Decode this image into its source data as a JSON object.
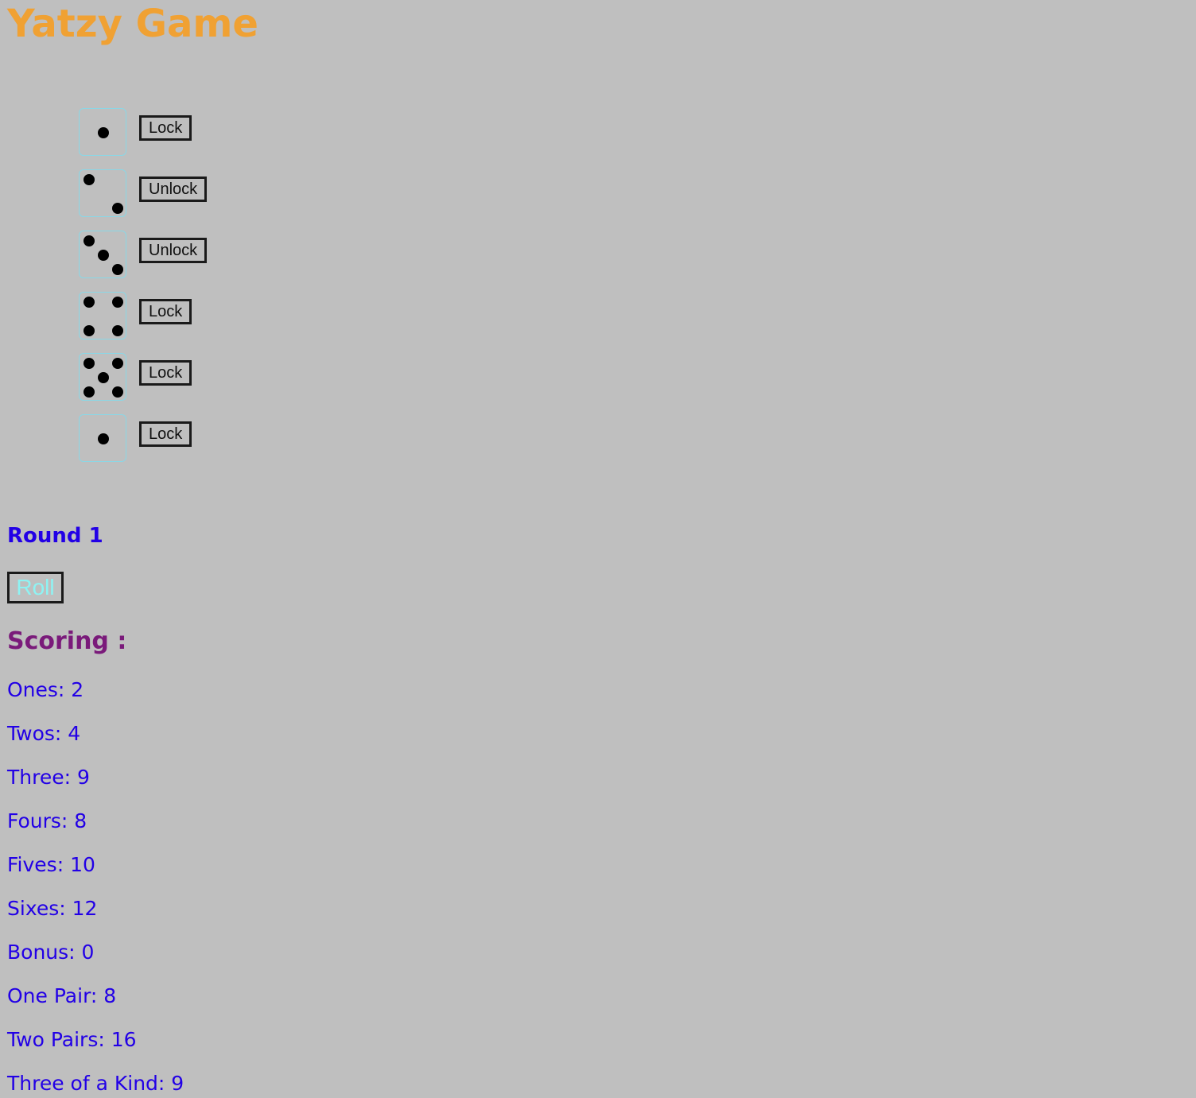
{
  "title": "Yatzy Game",
  "dice": [
    {
      "value": 1,
      "button_label": "Lock"
    },
    {
      "value": 2,
      "button_label": "Unlock"
    },
    {
      "value": 3,
      "button_label": "Unlock"
    },
    {
      "value": 4,
      "button_label": "Lock"
    },
    {
      "value": 5,
      "button_label": "Lock"
    },
    {
      "value": 1,
      "button_label": "Lock"
    }
  ],
  "round_label": "Round 1",
  "roll_label": "Roll",
  "scoring_title": "Scoring :",
  "scores": [
    "Ones: 2",
    "Twos: 4",
    "Three: 9",
    "Fours: 8",
    "Fives: 10",
    "Sixes: 12",
    "Bonus: 0",
    "One Pair: 8",
    "Two Pairs: 16",
    "Three of a Kind: 9"
  ],
  "colors": {
    "background": "#bfbfbf",
    "title": "#f0a133",
    "round": "#2200e6",
    "scoring_title": "#7a1a7a",
    "score_text": "#2200e6",
    "roll_text": "#8ef3f3",
    "die_border": "#8ad7e6"
  }
}
